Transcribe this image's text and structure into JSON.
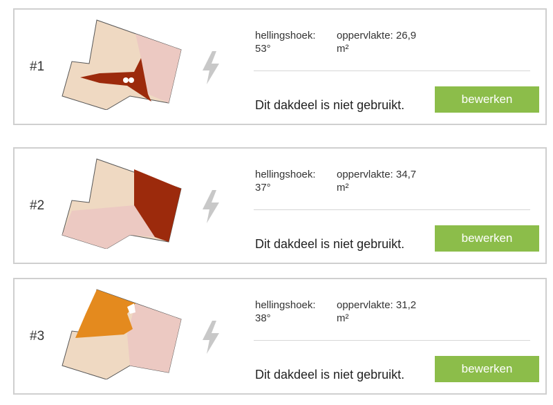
{
  "colors": {
    "button_bg": "#8cbd4a",
    "roof_light": "#efd9c2",
    "roof_pink": "#ecc9c2",
    "roof_dark": "#9c2a0c",
    "roof_orange": "#e48a1e",
    "bolt": "#c8c8c8"
  },
  "cards": [
    {
      "number": "#1",
      "slope_label": "hellingshoek:",
      "slope_value": "53°",
      "area_label": "oppervlakte: 26,9",
      "area_unit": "m²",
      "status": "Dit dakdeel is niet gebruikt.",
      "button_label": "bewerken"
    },
    {
      "number": "#2",
      "slope_label": "hellingshoek:",
      "slope_value": "37°",
      "area_label": "oppervlakte: 34,7",
      "area_unit": "m²",
      "status": "Dit dakdeel is niet gebruikt.",
      "button_label": "bewerken"
    },
    {
      "number": "#3",
      "slope_label": "hellingshoek:",
      "slope_value": "38°",
      "area_label": "oppervlakte: 31,2",
      "area_unit": "m²",
      "status": "Dit dakdeel is niet gebruikt.",
      "button_label": "bewerken"
    }
  ]
}
